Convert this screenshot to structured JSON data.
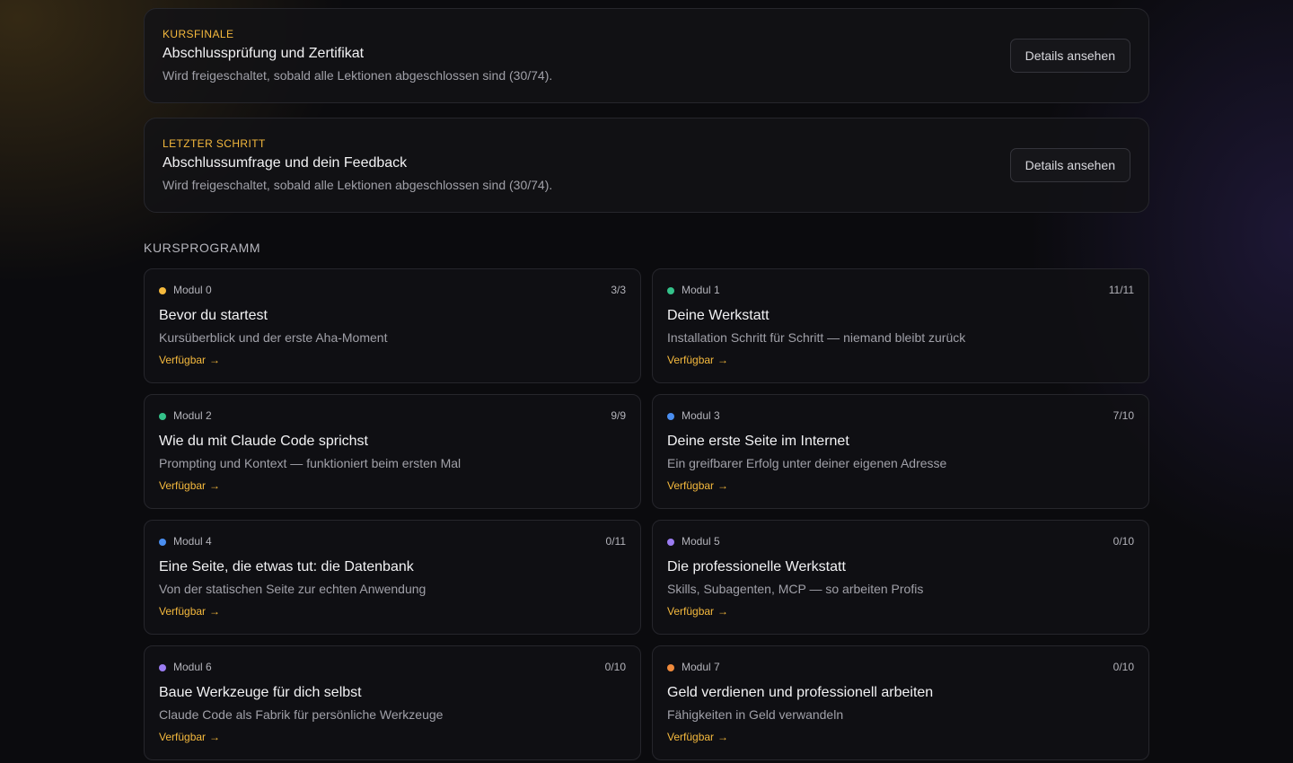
{
  "final_cards": [
    {
      "eyebrow": "KURSFINALE",
      "title": "Abschlussprüfung und Zertifikat",
      "description": "Wird freigeschaltet, sobald alle Lektionen abgeschlossen sind (30/74).",
      "button_label": "Details ansehen"
    },
    {
      "eyebrow": "LETZTER SCHRITT",
      "title": "Abschlussumfrage und dein Feedback",
      "description": "Wird freigeschaltet, sobald alle Lektionen abgeschlossen sind (30/74).",
      "button_label": "Details ansehen"
    }
  ],
  "program": {
    "heading": "KURSPROGRAMM",
    "link_label": "Verfügbar",
    "link_arrow": "→",
    "modules": [
      {
        "label": "Modul 0",
        "progress": "3/3",
        "title": "Bevor du startest",
        "description": "Kursüberblick und der erste Aha-Moment",
        "color": "#f5b93d"
      },
      {
        "label": "Modul 1",
        "progress": "11/11",
        "title": "Deine Werkstatt",
        "description": "Installation Schritt für Schritt — niemand bleibt zurück",
        "color": "#34c28a"
      },
      {
        "label": "Modul 2",
        "progress": "9/9",
        "title": "Wie du mit Claude Code sprichst",
        "description": "Prompting und Kontext — funktioniert beim ersten Mal",
        "color": "#34c28a"
      },
      {
        "label": "Modul 3",
        "progress": "7/10",
        "title": "Deine erste Seite im Internet",
        "description": "Ein greifbarer Erfolg unter deiner eigenen Adresse",
        "color": "#4a8ef0"
      },
      {
        "label": "Modul 4",
        "progress": "0/11",
        "title": "Eine Seite, die etwas tut: die Datenbank",
        "description": "Von der statischen Seite zur echten Anwendung",
        "color": "#4a8ef0"
      },
      {
        "label": "Modul 5",
        "progress": "0/10",
        "title": "Die professionelle Werkstatt",
        "description": "Skills, Subagenten, MCP — so arbeiten Profis",
        "color": "#9b7cf2"
      },
      {
        "label": "Modul 6",
        "progress": "0/10",
        "title": "Baue Werkzeuge für dich selbst",
        "description": "Claude Code als Fabrik für persönliche Werkzeuge",
        "color": "#9b7cf2"
      },
      {
        "label": "Modul 7",
        "progress": "0/10",
        "title": "Geld verdienen und professionell arbeiten",
        "description": "Fähigkeiten in Geld verwandeln",
        "color": "#f08a3c"
      }
    ]
  }
}
